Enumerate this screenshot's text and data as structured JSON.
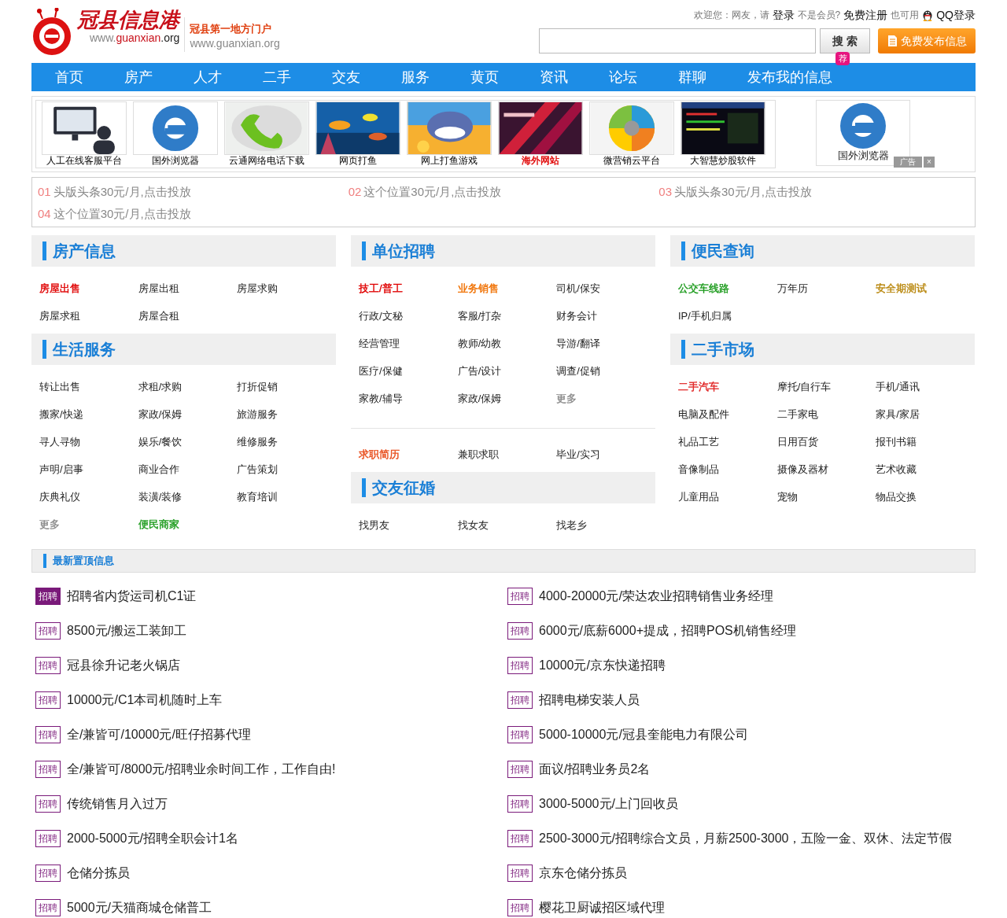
{
  "header": {
    "logo_title": "冠县信息港",
    "logo_url": [
      "www.",
      "guanxian",
      ".org"
    ],
    "slogan": "冠县第一地方门户",
    "slogan_url": "www.guanxian.org",
    "welcome": [
      {
        "text": "欢迎您：网友，请",
        "kind": "note"
      },
      {
        "text": "登录",
        "kind": "link"
      },
      {
        "text": "不是会员?",
        "kind": "note"
      },
      {
        "text": "免费注册",
        "kind": "link"
      },
      {
        "text": "也可用",
        "kind": "note"
      },
      {
        "text": "QQ登录",
        "kind": "qq"
      }
    ],
    "search_button": "搜 索",
    "publish_button": "免费发布信息"
  },
  "nav": [
    {
      "label": "首页"
    },
    {
      "label": "房产"
    },
    {
      "label": "人才"
    },
    {
      "label": "二手"
    },
    {
      "label": "交友"
    },
    {
      "label": "服务"
    },
    {
      "label": "黄页"
    },
    {
      "label": "资讯"
    },
    {
      "label": "论坛"
    },
    {
      "label": "群聊"
    },
    {
      "label": "发布我的信息",
      "badge": "荐"
    }
  ],
  "image_ads": [
    {
      "label": "人工在线客服平台"
    },
    {
      "label": "国外浏览器"
    },
    {
      "label": "云通网络电话下载"
    },
    {
      "label": "网页打鱼"
    },
    {
      "label": "网上打鱼游戏"
    },
    {
      "label": "海外网站",
      "color": "#e00000"
    },
    {
      "label": "微营销云平台"
    },
    {
      "label": "大智慧炒股软件"
    }
  ],
  "side_ad": {
    "label": "国外浏览器",
    "tag": "广告",
    "close": "×"
  },
  "text_ads": [
    {
      "number": "01",
      "text": "头版头条30元/月,点击投放"
    },
    {
      "number": "02",
      "text": "这个位置30元/月,点击投放"
    },
    {
      "number": "03",
      "text": "头版头条30元/月,点击投放"
    },
    {
      "number": "04",
      "text": "这个位置30元/月,点击投放"
    }
  ],
  "columns": [
    [
      {
        "title": "房产信息",
        "groups": [
          [
            {
              "label": "房屋出售",
              "color": "#e00000"
            },
            {
              "label": "房屋出租"
            },
            {
              "label": "房屋求购"
            },
            {
              "label": "房屋求租"
            },
            {
              "label": "房屋合租"
            }
          ]
        ]
      },
      {
        "title": "生活服务",
        "groups": [
          [
            {
              "label": "转让出售"
            },
            {
              "label": "求租/求购"
            },
            {
              "label": "打折促销"
            },
            {
              "label": "搬家/快递"
            },
            {
              "label": "家政/保姆"
            },
            {
              "label": "旅游服务"
            },
            {
              "label": "寻人寻物"
            },
            {
              "label": "娱乐/餐饮"
            },
            {
              "label": "维修服务"
            },
            {
              "label": "声明/启事"
            },
            {
              "label": "商业合作"
            },
            {
              "label": "广告策划"
            },
            {
              "label": "庆典礼仪"
            },
            {
              "label": "装潢/装修"
            },
            {
              "label": "教育培训"
            },
            {
              "label": "更多",
              "color": "#888888"
            },
            {
              "label": "便民商家",
              "color": "#1a9a1a"
            }
          ]
        ]
      }
    ],
    [
      {
        "title": "单位招聘",
        "groups": [
          [
            {
              "label": "技工/普工",
              "color": "#e00000"
            },
            {
              "label": "业务销售",
              "color": "#f07000"
            },
            {
              "label": "司机/保安"
            },
            {
              "label": "行政/文秘"
            },
            {
              "label": "客服/打杂"
            },
            {
              "label": "财务会计"
            },
            {
              "label": "经营管理"
            },
            {
              "label": "教师/幼教"
            },
            {
              "label": "导游/翻译"
            },
            {
              "label": "医疗/保健"
            },
            {
              "label": "广告/设计"
            },
            {
              "label": "调查/促销"
            },
            {
              "label": "家教/辅导"
            },
            {
              "label": "家政/保姆"
            },
            {
              "label": "更多",
              "color": "#888888"
            }
          ],
          [
            {
              "label": "求职简历",
              "color": "#e84c1a"
            },
            {
              "label": "兼职求职"
            },
            {
              "label": "毕业/实习"
            }
          ]
        ]
      },
      {
        "title": "交友征婚",
        "groups": [
          [
            {
              "label": "找男友"
            },
            {
              "label": "找女友"
            },
            {
              "label": "找老乡"
            }
          ]
        ]
      }
    ],
    [
      {
        "title": "便民查询",
        "groups": [
          [
            {
              "label": "公交车线路",
              "color": "#1a9a1a"
            },
            {
              "label": "万年历"
            },
            {
              "label": "安全期测试",
              "color": "#b8860b"
            },
            {
              "label": "IP/手机归属"
            }
          ]
        ]
      },
      {
        "title": "二手市场",
        "groups": [
          [
            {
              "label": "二手汽车",
              "color": "#e02020"
            },
            {
              "label": "摩托/自行车"
            },
            {
              "label": "手机/通讯"
            },
            {
              "label": "电脑及配件"
            },
            {
              "label": "二手家电"
            },
            {
              "label": "家具/家居"
            },
            {
              "label": "礼品工艺"
            },
            {
              "label": "日用百货"
            },
            {
              "label": "报刊书籍"
            },
            {
              "label": "音像制品"
            },
            {
              "label": "摄像及器材"
            },
            {
              "label": "艺术收藏"
            },
            {
              "label": "儿童用品"
            },
            {
              "label": "宠物"
            },
            {
              "label": "物品交换"
            }
          ]
        ]
      }
    ]
  ],
  "top_listings": {
    "title": "最新置顶信息",
    "items": [
      {
        "tag": "招聘",
        "text": "招聘省内货运司机C1证",
        "highlighted": true
      },
      {
        "tag": "招聘",
        "text": "4000-20000元/荣达农业招聘销售业务经理",
        "highlighted": false
      },
      {
        "tag": "招聘",
        "text": "8500元/搬运工装卸工",
        "highlighted": false
      },
      {
        "tag": "招聘",
        "text": "6000元/底薪6000+提成，招聘POS机销售经理",
        "highlighted": false
      },
      {
        "tag": "招聘",
        "text": "冠县徐升记老火锅店",
        "highlighted": false
      },
      {
        "tag": "招聘",
        "text": "10000元/京东快递招聘",
        "highlighted": false
      },
      {
        "tag": "招聘",
        "text": "10000元/C1本司机随时上车",
        "highlighted": false
      },
      {
        "tag": "招聘",
        "text": "招聘电梯安装人员",
        "highlighted": false
      },
      {
        "tag": "招聘",
        "text": "全/兼皆可/10000元/旺仔招募代理",
        "highlighted": false
      },
      {
        "tag": "招聘",
        "text": "5000-10000元/冠县奎能电力有限公司",
        "highlighted": false
      },
      {
        "tag": "招聘",
        "text": "全/兼皆可/8000元/招聘业余时间工作，工作自由!",
        "highlighted": false
      },
      {
        "tag": "招聘",
        "text": "面议/招聘业务员2名",
        "highlighted": false
      },
      {
        "tag": "招聘",
        "text": "传统销售月入过万",
        "highlighted": false
      },
      {
        "tag": "招聘",
        "text": "3000-5000元/上门回收员",
        "highlighted": false
      },
      {
        "tag": "招聘",
        "text": "2000-5000元/招聘全职会计1名",
        "highlighted": false
      },
      {
        "tag": "招聘",
        "text": "2500-3000元/招聘综合文员，月薪2500-3000，五险一金、双休、法定节假",
        "highlighted": false
      },
      {
        "tag": "招聘",
        "text": "仓储分拣员",
        "highlighted": false
      },
      {
        "tag": "招聘",
        "text": "京东仓储分拣员",
        "highlighted": false
      },
      {
        "tag": "招聘",
        "text": "5000元/天猫商城仓储普工",
        "highlighted": false
      },
      {
        "tag": "招聘",
        "text": "樱花卫厨诚招区域代理",
        "highlighted": false
      }
    ]
  }
}
